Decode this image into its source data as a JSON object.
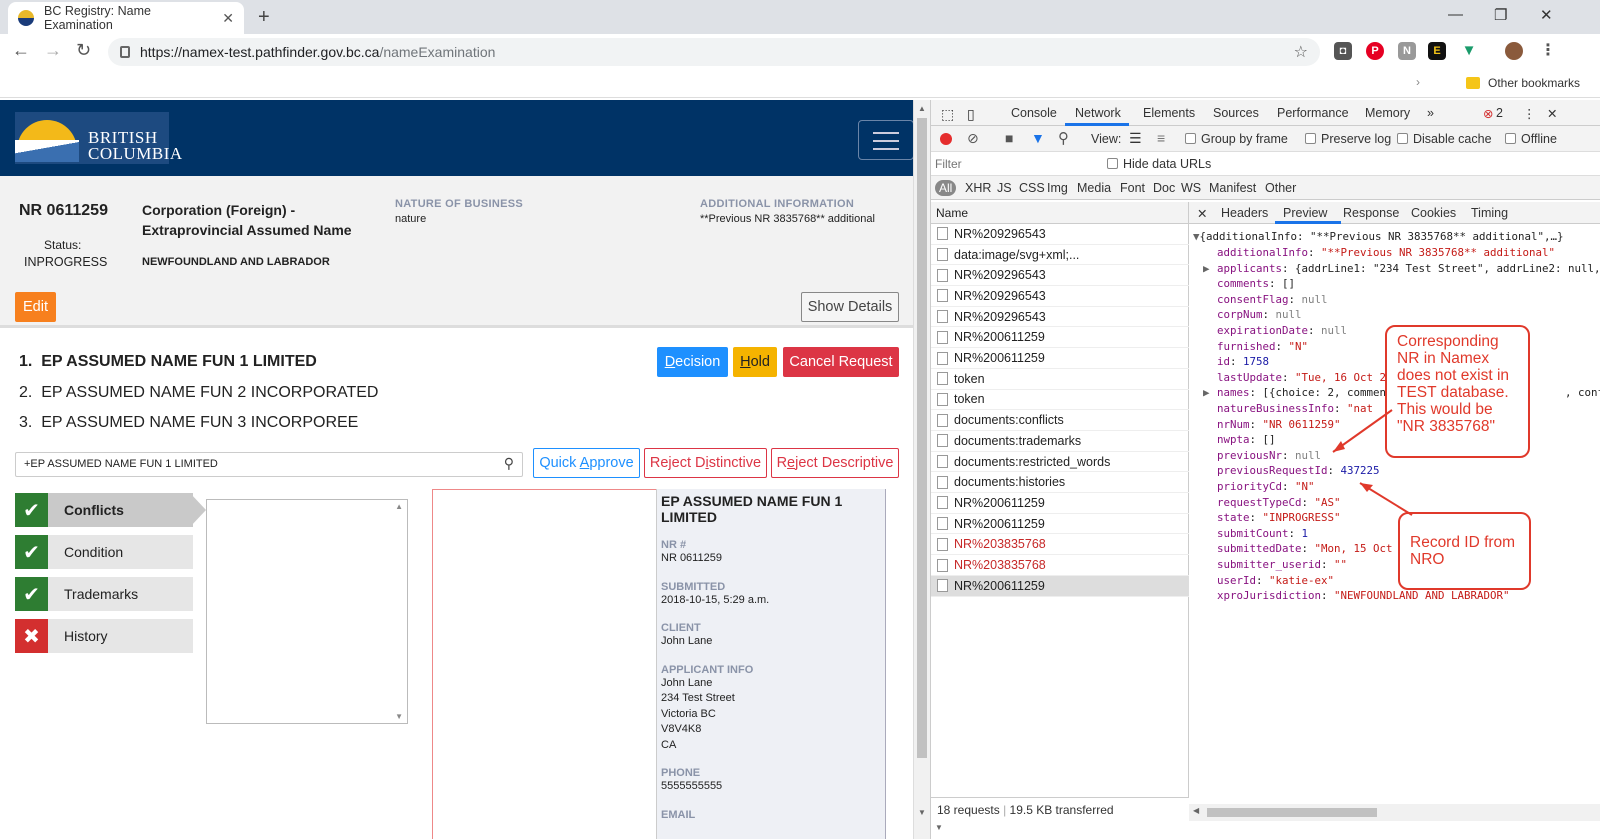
{
  "browser": {
    "tab_title": "BC Registry: Name Examination",
    "url_host": "https://namex-test.pathfinder.gov.bc.ca",
    "url_path": "/nameExamination",
    "other_bookmarks": "Other bookmarks"
  },
  "header": {
    "logo_line1": "BRITISH",
    "logo_line2": "COLUMBIA"
  },
  "summary": {
    "nr_number": "NR 0611259",
    "status_label": "Status:",
    "status_value": "INPROGRESS",
    "request_type_line1": "Corporation (Foreign) -",
    "request_type_line2": "Extraprovincial Assumed Name",
    "jurisdiction": "NEWFOUNDLAND AND LABRADOR",
    "nature_label": "NATURE OF BUSINESS",
    "nature_value": "nature",
    "additional_label": "ADDITIONAL INFORMATION",
    "additional_value": "**Previous NR 3835768** additional",
    "edit_button": "Edit",
    "show_details_button": "Show Details"
  },
  "names": [
    {
      "num": "1.",
      "text": "EP ASSUMED NAME FUN 1 LIMITED"
    },
    {
      "num": "2.",
      "text": "EP ASSUMED NAME FUN 2 INCORPORATED"
    },
    {
      "num": "3.",
      "text": "EP ASSUMED NAME FUN 3 INCORPOREE"
    }
  ],
  "actions": {
    "decision": "Decision",
    "hold": "Hold",
    "cancel": "Cancel Request",
    "quick_approve": "Quick Approve",
    "reject_distinctive": "Reject Distinctive",
    "reject_descriptive": "Reject Descriptive"
  },
  "search": {
    "value": "+EP ASSUMED NAME FUN 1 LIMITED"
  },
  "checks": [
    {
      "label": "Conflicts",
      "status": "pass"
    },
    {
      "label": "Condition",
      "status": "pass"
    },
    {
      "label": "Trademarks",
      "status": "pass"
    },
    {
      "label": "History",
      "status": "fail"
    }
  ],
  "detail": {
    "name_line1": "EP ASSUMED NAME FUN 1",
    "name_line2": "LIMITED",
    "nr_label": "NR #",
    "nr_value": "NR 0611259",
    "submitted_label": "SUBMITTED",
    "submitted_value": "2018-10-15, 5:29 a.m.",
    "client_label": "CLIENT",
    "client_value": "John Lane",
    "applicant_label": "APPLICANT INFO",
    "applicant_lines": [
      "John Lane",
      "234 Test Street",
      "Victoria BC",
      "V8V4K8",
      "CA"
    ],
    "phone_label": "PHONE",
    "phone_value": "5555555555",
    "email_label": "EMAIL"
  },
  "devtools": {
    "tabs": [
      "Console",
      "Network",
      "Elements",
      "Sources",
      "Performance",
      "Memory"
    ],
    "active_tab": "Network",
    "error_count": "2",
    "toolbar": {
      "view_label": "View:",
      "group_by_frame": "Group by frame",
      "preserve_log": "Preserve log",
      "disable_cache": "Disable cache",
      "offline": "Offline"
    },
    "filter_placeholder": "Filter",
    "hide_data_urls": "Hide data URLs",
    "types": [
      "All",
      "XHR",
      "JS",
      "CSS",
      "Img",
      "Media",
      "Font",
      "Doc",
      "WS",
      "Manifest",
      "Other"
    ],
    "name_header": "Name",
    "requests": [
      {
        "name": "NR%209296543",
        "style": ""
      },
      {
        "name": "data:image/svg+xml;...",
        "style": ""
      },
      {
        "name": "NR%209296543",
        "style": ""
      },
      {
        "name": "NR%209296543",
        "style": ""
      },
      {
        "name": "NR%209296543",
        "style": ""
      },
      {
        "name": "NR%200611259",
        "style": ""
      },
      {
        "name": "NR%200611259",
        "style": ""
      },
      {
        "name": "token",
        "style": ""
      },
      {
        "name": "token",
        "style": ""
      },
      {
        "name": "documents:conflicts",
        "style": ""
      },
      {
        "name": "documents:trademarks",
        "style": ""
      },
      {
        "name": "documents:restricted_words",
        "style": ""
      },
      {
        "name": "documents:histories",
        "style": ""
      },
      {
        "name": "NR%200611259",
        "style": ""
      },
      {
        "name": "NR%200611259",
        "style": ""
      },
      {
        "name": "NR%203835768",
        "style": "red"
      },
      {
        "name": "NR%203835768",
        "style": "red"
      },
      {
        "name": "NR%200611259",
        "style": "sel"
      }
    ],
    "status_requests": "18 requests",
    "status_transferred": "19.5 KB transferred",
    "preview_tabs": [
      "Headers",
      "Preview",
      "Response",
      "Cookies",
      "Timing"
    ],
    "active_preview_tab": "Preview",
    "preview_top": "{additionalInfo: \"**Previous NR 3835768** additional\",…}",
    "preview_lines": [
      {
        "key": "additionalInfo",
        "val": "\"**Previous NR 3835768** additional\"",
        "t": "s",
        "tri": false
      },
      {
        "key": "applicants",
        "val": "{addrLine1: \"234 Test Street\", addrLine2: null,",
        "t": "p",
        "tri": true
      },
      {
        "key": "comments",
        "val": "[]",
        "t": "p",
        "tri": false
      },
      {
        "key": "consentFlag",
        "val": "null",
        "t": "nl",
        "tri": false
      },
      {
        "key": "corpNum",
        "val": "null",
        "t": "nl",
        "tri": false
      },
      {
        "key": "expirationDate",
        "val": "null",
        "t": "nl",
        "tri": false
      },
      {
        "key": "furnished",
        "val": "\"N\"",
        "t": "s",
        "tri": false
      },
      {
        "key": "id",
        "val": "1758",
        "t": "n",
        "tri": false
      },
      {
        "key": "lastUpdate",
        "val": "\"Tue, 16 Oct 2",
        "t": "s",
        "tri": false
      },
      {
        "key": "names",
        "val": "[{choice: 2, commen",
        "t": "p",
        "tri": true
      },
      {
        "key": "natureBusinessInfo",
        "val": "\"nat",
        "t": "s",
        "tri": false
      },
      {
        "key": "nrNum",
        "val": "\"NR 0611259\"",
        "t": "s",
        "tri": false
      },
      {
        "key": "nwpta",
        "val": "[]",
        "t": "p",
        "tri": false
      },
      {
        "key": "previousNr",
        "val": "null",
        "t": "nl",
        "tri": false
      },
      {
        "key": "previousRequestId",
        "val": "437225",
        "t": "n",
        "tri": false
      },
      {
        "key": "priorityCd",
        "val": "\"N\"",
        "t": "s",
        "tri": false
      },
      {
        "key": "requestTypeCd",
        "val": "\"AS\"",
        "t": "s",
        "tri": false
      },
      {
        "key": "state",
        "val": "\"INPROGRESS\"",
        "t": "s",
        "tri": false
      },
      {
        "key": "submitCount",
        "val": "1",
        "t": "n",
        "tri": false
      },
      {
        "key": "submittedDate",
        "val": "\"Mon, 15 Oct",
        "t": "s",
        "tri": false
      },
      {
        "key": "submitter_userid",
        "val": "\"\"",
        "t": "s",
        "tri": false
      },
      {
        "key": "userId",
        "val": "\"katie-ex\"",
        "t": "s",
        "tri": false
      },
      {
        "key": "xproJurisdiction",
        "val": "\"NEWFOUNDLAND AND LABRADOR\"",
        "t": "s",
        "tri": false
      }
    ],
    "preview_conf_tail": ", conf"
  },
  "callouts": {
    "c1": "Corresponding NR in Namex does not exist in TEST database. This would be \"NR 3835768\"",
    "c2": "Record ID from NRO"
  },
  "colors": {
    "bc_blue": "#003366",
    "edit_orange": "#f7801e",
    "decision_blue": "#1e90ff",
    "hold_yellow": "#f5b300",
    "cancel_red": "#dc3545",
    "annotation_red": "#e0392b"
  }
}
